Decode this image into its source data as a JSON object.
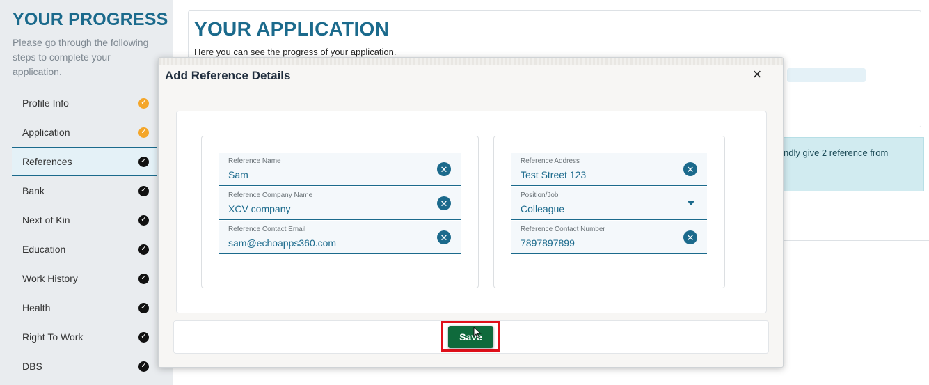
{
  "sidebar": {
    "title": "YOUR PROGRESS",
    "description": "Please go through the following steps to complete your application.",
    "steps": [
      {
        "label": "Profile Info",
        "status": "pending"
      },
      {
        "label": "Application",
        "status": "pending"
      },
      {
        "label": "References",
        "status": "done"
      },
      {
        "label": "Bank",
        "status": "done"
      },
      {
        "label": "Next of Kin",
        "status": "done"
      },
      {
        "label": "Education",
        "status": "done"
      },
      {
        "label": "Work History",
        "status": "done"
      },
      {
        "label": "Health",
        "status": "done"
      },
      {
        "label": "Right To Work",
        "status": "done"
      },
      {
        "label": "DBS",
        "status": "done"
      }
    ]
  },
  "main": {
    "title": "YOUR APPLICATION",
    "description": "Here you can see the progress of your application.",
    "info_text": "ndly give 2 reference from"
  },
  "modal": {
    "title": "Add Reference Details",
    "close_icon": "×",
    "left_fields": [
      {
        "label": "Reference Name",
        "value": "Sam"
      },
      {
        "label": "Reference Company Name",
        "value": "XCV company"
      },
      {
        "label": "Reference Contact Email",
        "value": "sam@echoapps360.com"
      }
    ],
    "right_fields": [
      {
        "label": "Reference Address",
        "value": "Test Street 123",
        "type": "text"
      },
      {
        "label": "Position/Job",
        "value": "Colleague",
        "type": "select"
      },
      {
        "label": "Reference Contact Number",
        "value": "7897897899",
        "type": "text"
      }
    ],
    "save_label": "Save"
  },
  "colors": {
    "primary": "#1b6a8c",
    "save_button": "#0f6a3c",
    "highlight": "#e0101a",
    "pending_check": "#f4a62a",
    "done_check": "#111111"
  }
}
